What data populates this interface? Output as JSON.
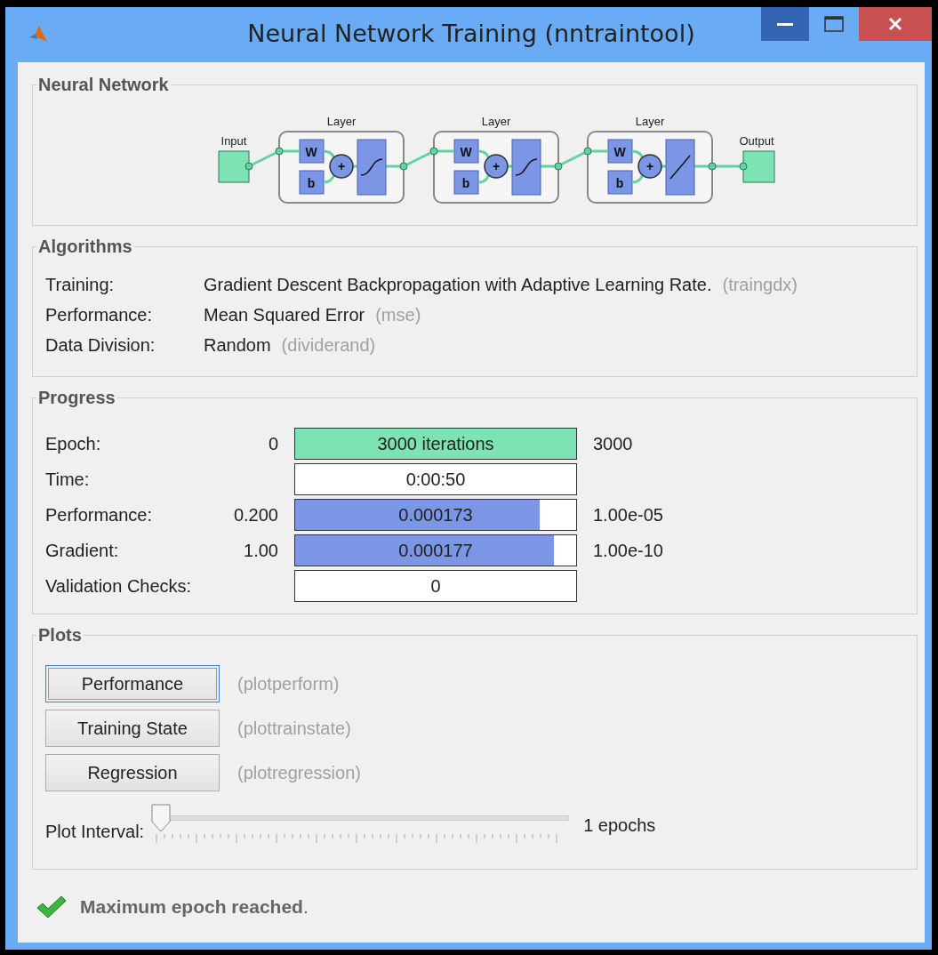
{
  "window": {
    "title": "Neural Network Training (nntraintool)"
  },
  "network": {
    "title": "Neural Network",
    "input": "Input",
    "output": "Output",
    "layers": [
      {
        "label": "Layer",
        "weight": "W",
        "bias": "b",
        "sum": "+",
        "kind": "sigmoid"
      },
      {
        "label": "Layer",
        "weight": "W",
        "bias": "b",
        "sum": "+",
        "kind": "sigmoid"
      },
      {
        "label": "Layer",
        "weight": "W",
        "bias": "b",
        "sum": "+",
        "kind": "linear"
      }
    ]
  },
  "algorithms": {
    "title": "Algorithms",
    "rows": [
      {
        "label": "Training:",
        "value": "Gradient Descent Backpropagation with Adaptive Learning Rate.",
        "code": "(traingdx)"
      },
      {
        "label": "Performance:",
        "value": "Mean Squared Error",
        "code": "(mse)"
      },
      {
        "label": "Data Division:",
        "value": "Random",
        "code": "(dividerand)"
      }
    ]
  },
  "progress": {
    "title": "Progress",
    "rows": [
      {
        "label": "Epoch:",
        "min": "0",
        "value": "3000 iterations",
        "max": "3000",
        "level": 1,
        "color": "#7de3b5"
      },
      {
        "label": "Time:",
        "value": "0:00:50"
      },
      {
        "label": "Performance:",
        "min": "0.200",
        "value": "0.000173",
        "max": "1.00e-05",
        "level": 0.87,
        "color": "#7b96e4"
      },
      {
        "label": "Gradient:",
        "min": "1.00",
        "value": "0.000177",
        "max": "1.00e-10",
        "level": 0.92,
        "color": "#7b96e4"
      },
      {
        "label": "Validation Checks:",
        "value": "0"
      }
    ]
  },
  "plots": {
    "title": "Plots",
    "buttons": [
      {
        "label": "Performance",
        "function": "(plotperform)",
        "selected": true
      },
      {
        "label": "Training State",
        "function": "(plottrainstate)",
        "selected": false
      },
      {
        "label": "Regression",
        "function": "(plotregression)",
        "selected": false
      }
    ],
    "interval": {
      "label": "Plot Interval:",
      "level": 0,
      "reading": "1 epochs"
    }
  },
  "status": {
    "message": "**Maximum epoch reached**.",
    "kind": "success"
  }
}
